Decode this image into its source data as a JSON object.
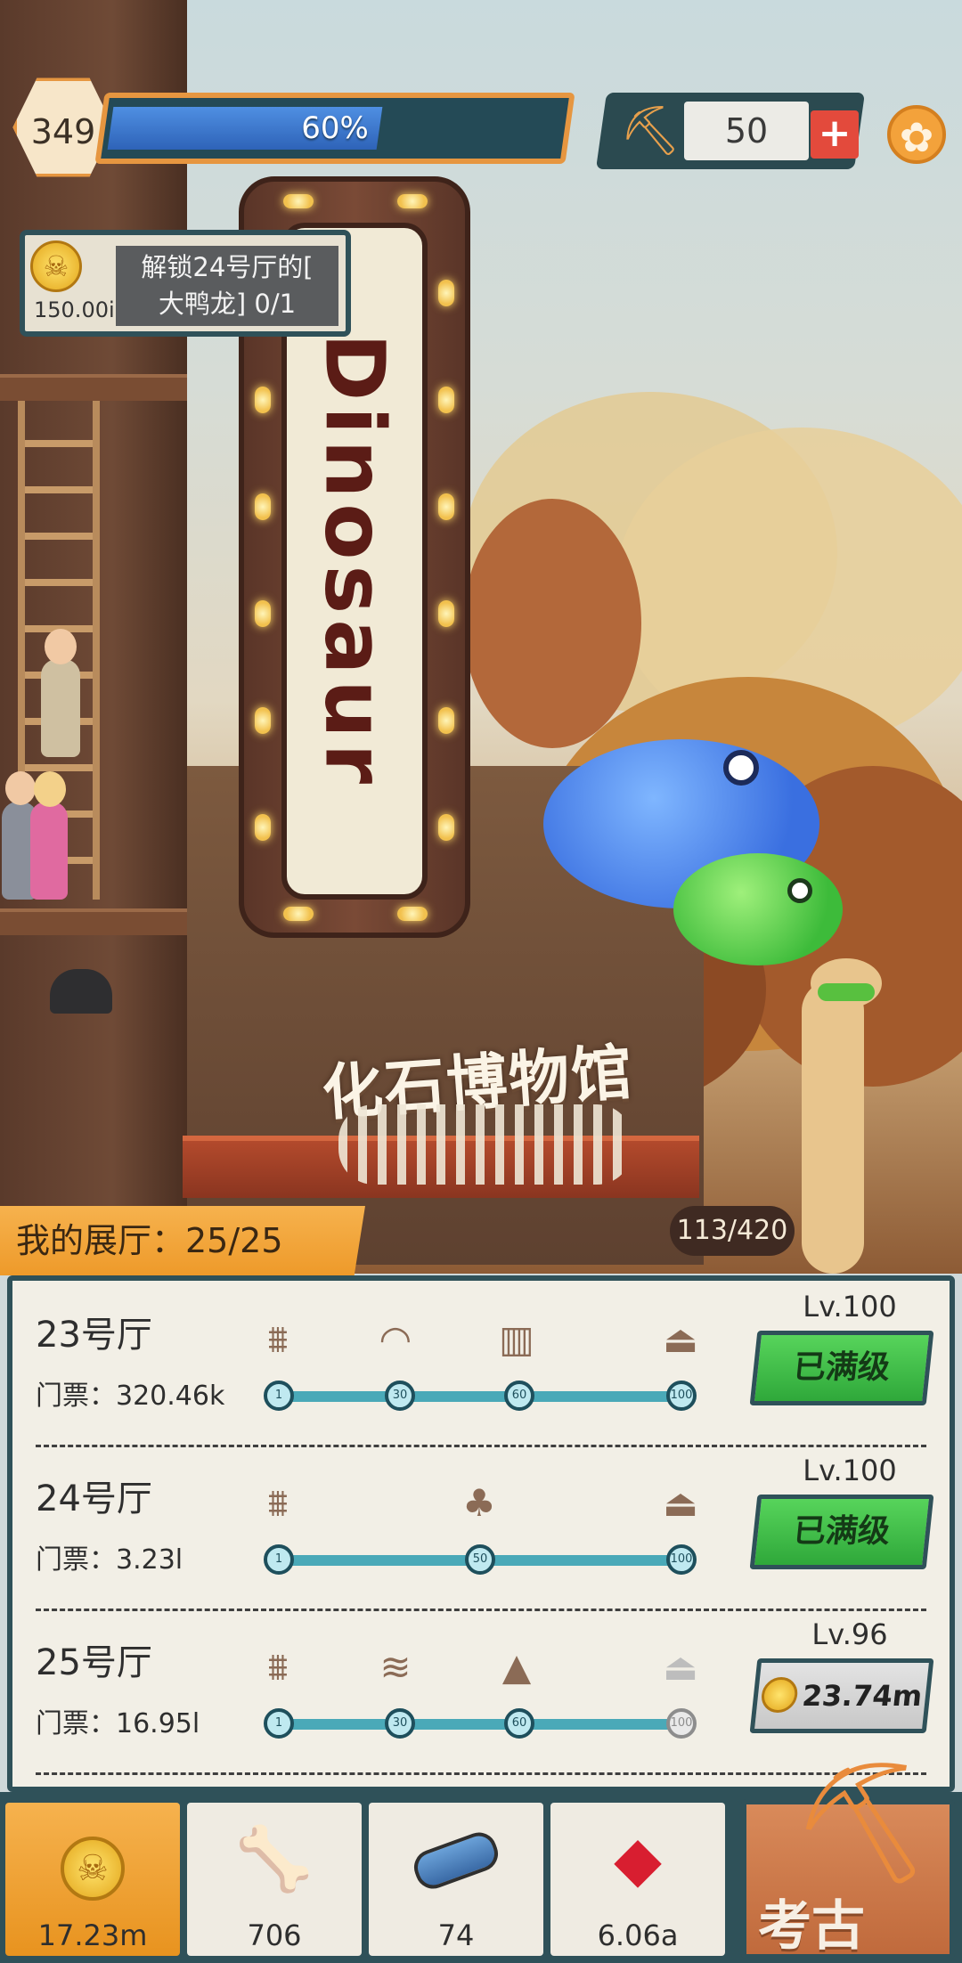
{
  "hud": {
    "level": "349",
    "xp_percent_text": "60%",
    "xp_fraction": 0.6,
    "pickaxe_count": "50",
    "plus_label": "+",
    "icons": {
      "pickaxe": "pickaxe-icon",
      "settings": "gear-icon",
      "add": "plus-icon"
    }
  },
  "quest": {
    "reward": "150.00i",
    "text_line1": "解锁24号厅的[",
    "text_line2": "大鸭龙] 0/1"
  },
  "scene": {
    "sign_text": "Dinosaur",
    "museum_title": "化石博物馆",
    "hall_count": "我的展厅：25/25",
    "visitors": "113/420"
  },
  "halls": [
    {
      "name": "23号厅",
      "ticket": "门票：320.46k",
      "level": "Lv.100",
      "button": "已满级",
      "nodes": [
        "1",
        "30",
        "60",
        "100"
      ]
    },
    {
      "name": "24号厅",
      "ticket": "门票：3.23l",
      "level": "Lv.100",
      "button": "已满级",
      "nodes": [
        "1",
        "50",
        "100"
      ]
    },
    {
      "name": "25号厅",
      "ticket": "门票：16.95l",
      "level": "Lv.96",
      "button": "23.74m",
      "nodes": [
        "1",
        "30",
        "60",
        "100"
      ]
    }
  ],
  "resources": [
    {
      "name": "coins",
      "value": "17.23m",
      "icon": "skull-coin-icon"
    },
    {
      "name": "bones",
      "value": "706",
      "icon": "bone-icon"
    },
    {
      "name": "scrolls",
      "value": "74",
      "icon": "scroll-icon"
    },
    {
      "name": "gems",
      "value": "6.06a",
      "icon": "ruby-icon"
    }
  ],
  "dig_button": "考古",
  "colors": {
    "accent_orange": "#ee9a2a",
    "panel_teal": "#2f5159",
    "green_button": "#2fa83a",
    "xp_blue": "#2e63b8"
  }
}
